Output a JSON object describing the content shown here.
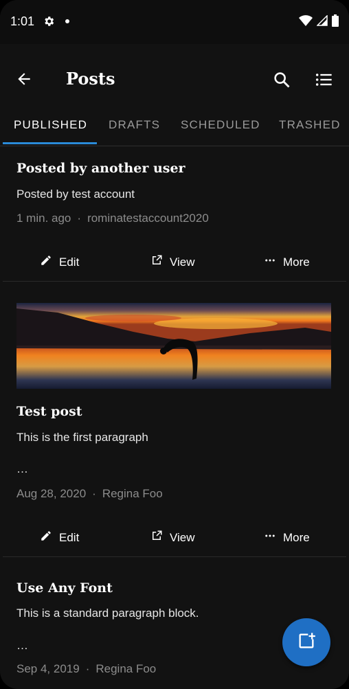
{
  "status_bar": {
    "time": "1:01"
  },
  "app_bar": {
    "title": "Posts"
  },
  "tabs": [
    {
      "label": "PUBLISHED",
      "active": true
    },
    {
      "label": "DRAFTS",
      "active": false
    },
    {
      "label": "SCHEDULED",
      "active": false
    },
    {
      "label": "TRASHED",
      "active": false
    }
  ],
  "posts": [
    {
      "title": "Posted by another user",
      "excerpt": "Posted by test account",
      "date": "1 min. ago",
      "author": "rominatestaccount2020",
      "has_image": false
    },
    {
      "title": "Test post",
      "excerpt": "This is the first paragraph",
      "ellipsis": "…",
      "date": "Aug 28, 2020",
      "author": "Regina Foo",
      "has_image": true
    },
    {
      "title": "Use Any Font",
      "excerpt": "This is a standard paragraph block.",
      "ellipsis": "…",
      "date": "Sep 4, 2019",
      "author": "Regina Foo",
      "has_image": false
    }
  ],
  "actions": {
    "edit": "Edit",
    "view": "View",
    "more": "More",
    "separator": "·"
  },
  "colors": {
    "accent": "#2a8bd8",
    "fab": "#1f6fc4",
    "background": "#121212"
  },
  "icons": [
    "gear-icon",
    "wifi-icon",
    "signal-icon",
    "battery-icon",
    "back-arrow-icon",
    "search-icon",
    "filter-list-icon",
    "pencil-icon",
    "external-link-icon",
    "more-dots-icon",
    "add-post-icon"
  ]
}
